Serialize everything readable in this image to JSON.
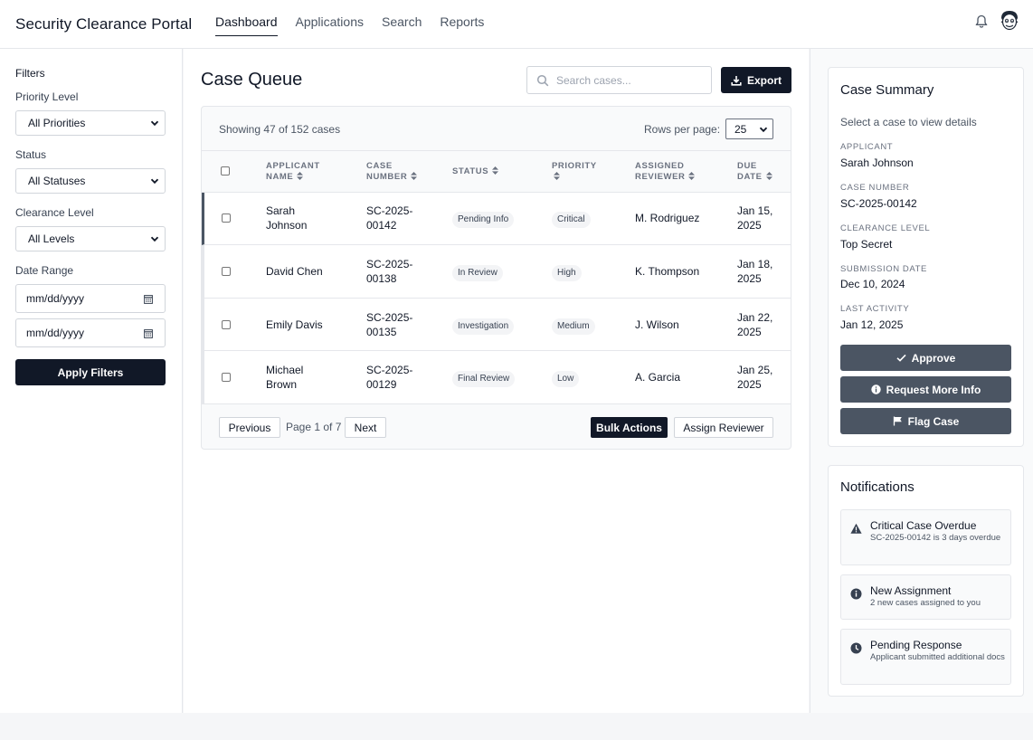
{
  "app": {
    "title": "Security Clearance Portal"
  },
  "nav": {
    "items": [
      {
        "label": "Dashboard",
        "active": true
      },
      {
        "label": "Applications",
        "active": false
      },
      {
        "label": "Search",
        "active": false
      },
      {
        "label": "Reports",
        "active": false
      }
    ]
  },
  "header_icons": [
    "bell-icon",
    "user-avatar"
  ],
  "filters": {
    "title": "Filters",
    "priority_label": "Priority Level",
    "priority_value": "All Priorities",
    "status_label": "Status",
    "status_value": "All Statuses",
    "clearance_label": "Clearance Level",
    "clearance_value": "All Levels",
    "date_label": "Date Range",
    "date_from_placeholder": "mm/dd/yyyy",
    "date_to_placeholder": "mm/dd/yyyy",
    "apply_label": "Apply Filters"
  },
  "queue": {
    "title": "Case Queue",
    "search_placeholder": "Search cases...",
    "export_label": "Export",
    "showing_text": "Showing 47 of 152 cases",
    "rows_per_page_label": "Rows per page:",
    "rows_per_page_value": "25",
    "columns": {
      "applicant_line1": "APPLICANT",
      "applicant_line2": "NAME",
      "case_line1": "CASE",
      "case_line2": "NUMBER",
      "status": "STATUS",
      "priority": "PRIORITY",
      "reviewer_line1": "ASSIGNED",
      "reviewer_line2": "REVIEWER",
      "due_line1": "DUE",
      "due_line2": "DATE"
    },
    "rows": [
      {
        "name1": "Sarah",
        "name2": "Johnson",
        "case1": "SC-2025-",
        "case2": "00142",
        "status": "Pending Info",
        "priority": "Critical",
        "reviewer": "M. Rodriguez",
        "due1": "Jan 15,",
        "due2": "2025"
      },
      {
        "name1": "David Chen",
        "name2": "",
        "case1": "SC-2025-",
        "case2": "00138",
        "status": "In Review",
        "priority": "High",
        "reviewer": "K. Thompson",
        "due1": "Jan 18,",
        "due2": "2025"
      },
      {
        "name1": "Emily Davis",
        "name2": "",
        "case1": "SC-2025-",
        "case2": "00135",
        "status": "Investigation",
        "priority": "Medium",
        "reviewer": "J. Wilson",
        "due1": "Jan 22,",
        "due2": "2025"
      },
      {
        "name1": "Michael",
        "name2": "Brown",
        "case1": "SC-2025-",
        "case2": "00129",
        "status": "Final Review",
        "priority": "Low",
        "reviewer": "A. Garcia",
        "due1": "Jan 25,",
        "due2": "2025"
      }
    ],
    "pagination": {
      "previous_label": "Previous",
      "page_info": "Page 1 of 7",
      "next_label": "Next",
      "bulk_label": "Bulk Actions",
      "assign_label": "Assign Reviewer"
    }
  },
  "summary": {
    "title": "Case Summary",
    "hint": "Select a case to view details",
    "applicant_label": "APPLICANT",
    "applicant_value": "Sarah Johnson",
    "case_label": "CASE NUMBER",
    "case_value": "SC-2025-00142",
    "clearance_label": "CLEARANCE LEVEL",
    "clearance_value": "Top Secret",
    "submission_label": "SUBMISSION DATE",
    "submission_value": "Dec 10, 2024",
    "activity_label": "LAST ACTIVITY",
    "activity_value": "Jan 12, 2025",
    "approve_label": "Approve",
    "request_label": "Request More Info",
    "flag_label": "Flag Case"
  },
  "notifications": {
    "title": "Notifications",
    "items": [
      {
        "icon": "warning-icon",
        "title": "Critical Case Overdue",
        "desc": "SC-2025-00142 is 3 days overdue"
      },
      {
        "icon": "info-icon",
        "title": "New Assignment",
        "desc": "2 new cases assigned to you"
      },
      {
        "icon": "clock-icon",
        "title": "Pending Response",
        "desc": "Applicant submitted additional docs"
      }
    ]
  },
  "colors": {
    "primary_dark": "#111827",
    "action_gray": "#4b5563",
    "border": "#e5e7eb",
    "pill_bg": "#f3f4f6"
  }
}
